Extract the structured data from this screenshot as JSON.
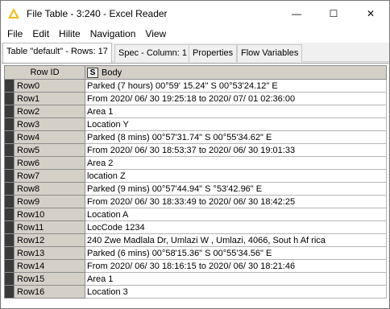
{
  "window": {
    "title": "File Table - 3:240 - Excel Reader",
    "minimize_glyph": "—",
    "maximize_glyph": "☐",
    "close_glyph": "✕"
  },
  "menu": {
    "items": [
      "File",
      "Edit",
      "Hilite",
      "Navigation",
      "View"
    ]
  },
  "tabs": [
    {
      "label": "Table \"default\" - Rows: 17"
    },
    {
      "label": "Spec - Column: 1"
    },
    {
      "label": "Properties"
    },
    {
      "label": "Flow Variables"
    }
  ],
  "table": {
    "columns": [
      {
        "label": "Row ID"
      },
      {
        "type_badge": "S",
        "label": "Body"
      }
    ],
    "rows": [
      {
        "id": "Row0",
        "body": "Parked (7 hours) 00°59' 15.24\" S 00°53'24.12\" E"
      },
      {
        "id": "Row1",
        "body": "From 2020/ 06/ 30 19:25:18 to 2020/ 07/ 01 02:36:00"
      },
      {
        "id": "Row2",
        "body": "Area 1"
      },
      {
        "id": "Row3",
        "body": "Location Y"
      },
      {
        "id": "Row4",
        "body": "Parked (8 mins) 00°57'31.74\" S 00°55'34.62\" E"
      },
      {
        "id": "Row5",
        "body": "From 2020/ 06/ 30 18:53:37 to 2020/ 06/ 30 19:01:33"
      },
      {
        "id": "Row6",
        "body": "Area 2"
      },
      {
        "id": "Row7",
        "body": "location Z"
      },
      {
        "id": "Row8",
        "body": "Parked (9 mins) 00°57'44.94\" S °53'42.96\" E"
      },
      {
        "id": "Row9",
        "body": "From 2020/ 06/ 30 18:33:49 to 2020/ 06/ 30 18:42:25"
      },
      {
        "id": "Row10",
        "body": "Location A"
      },
      {
        "id": "Row11",
        "body": "LocCode 1234"
      },
      {
        "id": "Row12",
        "body": "240 Zwe Madlala Dr, Umlazi W , Umlazi, 4066, Sout h Af rica"
      },
      {
        "id": "Row13",
        "body": "Parked (6 mins) 00°58'15.36\" S 00°55'34.56\" E"
      },
      {
        "id": "Row14",
        "body": "From 2020/ 06/ 30 18:16:15 to 2020/ 06/ 30 18:21:46"
      },
      {
        "id": "Row15",
        "body": "Area 1"
      },
      {
        "id": "Row16",
        "body": "Location 3"
      }
    ]
  },
  "colors": {
    "accent_icon": "#f2b91d",
    "row_marker": "#3a3a3a",
    "header_bg": "#d4d0c8"
  }
}
